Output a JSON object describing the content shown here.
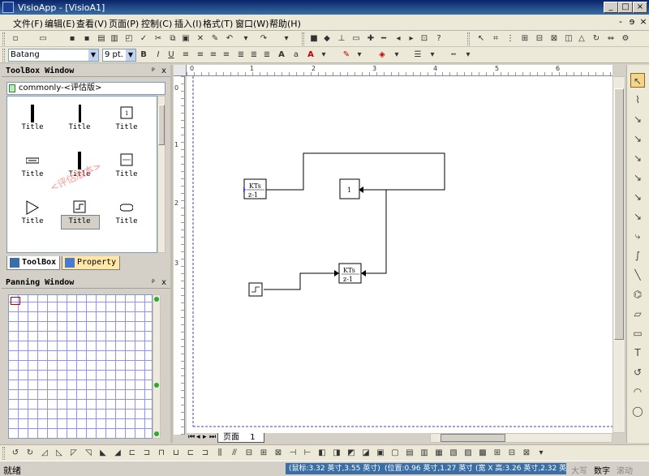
{
  "window": {
    "title": "VisioApp - [VisioA1]",
    "btn_min": "_",
    "btn_max": "□",
    "btn_close": "×"
  },
  "menu": {
    "items": [
      "文件(F)",
      "编辑(E)",
      "查看(V)",
      "页面(P)",
      "控制(C)",
      "插入(I)",
      "格式(T)",
      "窗口(W)",
      "帮助(H)"
    ],
    "mdi_min": "-",
    "mdi_restore": "ɘ",
    "mdi_close": "×"
  },
  "format_toolbar": {
    "font": "Batang",
    "size": "9 pt.",
    "bold": "B",
    "italic": "I",
    "underline": "U",
    "font_color_glyph": "A"
  },
  "toolbox": {
    "title": "ToolBox Window",
    "pin": "ᵖ",
    "close": "x",
    "path": "commonly-<评估版>",
    "watermark": "<评估版本>",
    "items": [
      {
        "label": "Title",
        "icon": "vertical-bar-thick-icon"
      },
      {
        "label": "Title",
        "icon": "vertical-bar-icon"
      },
      {
        "label": "Title",
        "icon": "constant-block-icon"
      },
      {
        "label": "Title",
        "icon": "scope-block-icon"
      },
      {
        "label": "Title",
        "icon": "mux-bar-icon"
      },
      {
        "label": "Title",
        "icon": "transfer-function-block-icon"
      },
      {
        "label": "Title",
        "icon": "gain-triangle-icon"
      },
      {
        "label": "Title",
        "icon": "step-source-icon"
      },
      {
        "label": "Title",
        "icon": "rounded-terminator-icon"
      }
    ],
    "tabs": [
      {
        "label": "ToolBox",
        "active": true
      },
      {
        "label": "Property",
        "active": false
      }
    ]
  },
  "panning": {
    "title": "Panning Window",
    "pin": "ᵖ",
    "close": "x"
  },
  "rulers": {
    "h_labels": [
      "0",
      "1",
      "2",
      "3",
      "4",
      "5",
      "6"
    ],
    "v_labels": [
      "0",
      "1",
      "2",
      "3"
    ]
  },
  "diagram": {
    "block_tf1": {
      "num": "KTs",
      "den": "z-1"
    },
    "block_const": {
      "text": "1"
    },
    "block_tf2": {
      "num": "KTs",
      "den": "z-1"
    }
  },
  "page_tab": {
    "label": "页面",
    "number": "1"
  },
  "status": {
    "ready": "就绪",
    "mouse": "(鼠标:3.32 英寸,3.55 英寸)",
    "position": "(位置:0.96 英寸,1.27 英寸)",
    "size": "(宽 X 高:3.26 英寸,2.32 英寸)",
    "caps": "大写",
    "num": "数字",
    "scroll": "滚动"
  },
  "colors": {
    "titlebar": "#0a246a",
    "watermark": "#ff9a9a",
    "grid": "#9090ff",
    "status_highlight": "#3a6ea5"
  }
}
